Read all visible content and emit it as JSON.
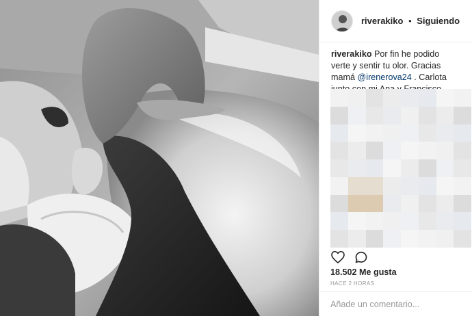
{
  "post": {
    "username": "riverakiko",
    "separator": "•",
    "follow_status": "Siguiendo",
    "caption": {
      "username": "riverakiko",
      "text_before_mention": "Por fin he podido verte y sentir tu olor. Gracias mamá ",
      "mention": "@irenerova24",
      "text_after_mention": " . Carlota junto con mi Ana y Francisco complementa mi felicidad perfecta."
    },
    "likes": "18.502 Me gusta",
    "timestamp": "HACE 2 HORAS",
    "comment_placeholder": "Añade un comentario..."
  },
  "icons": {
    "like": "heart-icon",
    "comment": "comment-bubble-icon"
  },
  "colors": {
    "mention": "#003569",
    "text": "#262626",
    "muted": "#999999",
    "border": "#efefef"
  }
}
